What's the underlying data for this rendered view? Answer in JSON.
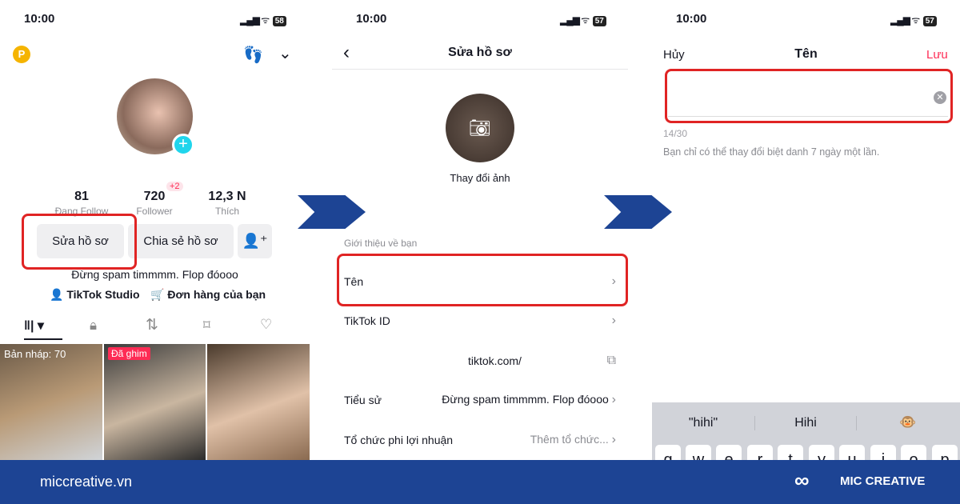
{
  "status": [
    {
      "time": "10:00",
      "battery": "58"
    },
    {
      "time": "10:00",
      "battery": "57"
    },
    {
      "time": "10:00",
      "battery": "57"
    }
  ],
  "profile": {
    "coin_icon": "P",
    "stats": [
      {
        "value": "81",
        "label": "Đang Follow"
      },
      {
        "value": "720",
        "label": "Follower",
        "badge": "+2"
      },
      {
        "value": "12,3 N",
        "label": "Thích"
      }
    ],
    "edit_button": "Sửa hồ sơ",
    "share_button": "Chia sẻ hồ sơ",
    "bio": "Đừng spam timmmm. Flop đóooo",
    "studio_link": "TikTok Studio",
    "orders_link": "Đơn hàng của bạn",
    "drafts_label": "Bản nháp: 70",
    "pinned_label": "Đã ghim"
  },
  "edit": {
    "title": "Sửa hồ sơ",
    "change_photo": "Thay đổi ảnh",
    "section": "Giới thiệu về bạn",
    "rows": [
      {
        "label": "Tên",
        "value": ""
      },
      {
        "label": "TikTok ID",
        "value": ""
      },
      {
        "label": "",
        "value": "tiktok.com/"
      },
      {
        "label": "Tiểu sử",
        "value": "Đừng spam timmmm. Flop đóooo"
      },
      {
        "label": "Tổ chức phi lợi nhuận",
        "value": "Thêm tổ chức..."
      }
    ]
  },
  "name_edit": {
    "cancel": "Hủy",
    "title": "Tên",
    "save": "Lưu",
    "input_value": "",
    "counter": "14/30",
    "hint": "Bạn chỉ có thể thay đổi biệt danh 7 ngày một lần.",
    "suggestions": [
      "\"hihi\"",
      "Hihi",
      "🐵"
    ],
    "keys": [
      "q",
      "w",
      "e",
      "r",
      "t",
      "y",
      "u",
      "i",
      "o",
      "p"
    ]
  },
  "footer": {
    "site": "miccreative.vn",
    "brand": "MIC CREATIVE"
  },
  "colors": {
    "accent": "#fe2c55",
    "brand": "#1d4494",
    "highlight": "#e02424"
  }
}
